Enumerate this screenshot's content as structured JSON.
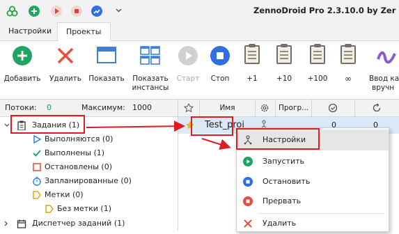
{
  "window": {
    "title": "ZennoDroid Pro 2.3.10.0 by Zer"
  },
  "tabs": [
    {
      "label": "Настройки"
    },
    {
      "label": "Проекты"
    }
  ],
  "ribbon": {
    "add": "Добавить",
    "delete": "Удалить",
    "show": "Показать",
    "show_instances_1": "Показать",
    "show_instances_2": "инстансы",
    "start": "Старт",
    "stop": "Стоп",
    "plus1": "+1",
    "plus10": "+10",
    "plus100": "+100",
    "infinity": "∞",
    "manual_1": "Ввод ка",
    "manual_2": "вручн"
  },
  "stats": {
    "threads_label": "Потоки:",
    "threads_value": "0",
    "max_label": "Максимум:",
    "max_value": "1000"
  },
  "tree": {
    "tasks": "Задания (1)",
    "running": "Выполняются (0)",
    "done": "Выполнены (1)",
    "stopped": "Остановлены (0)",
    "scheduled": "Запланированные (0)",
    "labels": "Метки (0)",
    "no_label": "Без метки (1)",
    "dispatcher": "Диспетчер заданий (1)"
  },
  "grid": {
    "col_name": "Имя",
    "col_progress": "Прогр...",
    "row_name": "Test_proj",
    "row_val1": "0",
    "row_val2": "0"
  },
  "context_menu": {
    "items": [
      {
        "label": "Настройки"
      },
      {
        "label": "Запустить"
      },
      {
        "label": "Остановить"
      },
      {
        "label": "Прервать"
      },
      {
        "label": "Удалить"
      }
    ]
  },
  "colors": {
    "accent_green": "#1fa463",
    "accent_red": "#e84c3d",
    "accent_blue": "#2f6fe0",
    "annotation_red": "#e11b22"
  }
}
